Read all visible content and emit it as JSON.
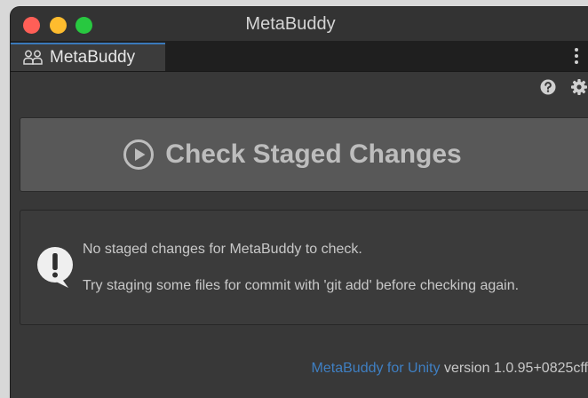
{
  "window": {
    "title": "MetaBuddy"
  },
  "tab": {
    "label": "MetaBuddy",
    "icon": "people-icon"
  },
  "toolbar": {
    "help_icon": "question-circle-icon",
    "settings_icon": "gear-icon",
    "menu_icon": "kebab-menu-icon"
  },
  "check_button": {
    "label": "Check Staged Changes",
    "icon": "play-circle-icon"
  },
  "message": {
    "icon": "exclamation-bubble-icon",
    "line1": "No staged changes for MetaBuddy to check.",
    "line2": "Try staging some files for commit with 'git add' before checking again."
  },
  "footer": {
    "link_text": "MetaBuddy for Unity",
    "version_text": " version 1.0.95+0825cff"
  },
  "colors": {
    "accent": "#3a79bb",
    "link": "#3f7fc2",
    "button_bg": "#585858",
    "panel_bg": "#383838"
  }
}
